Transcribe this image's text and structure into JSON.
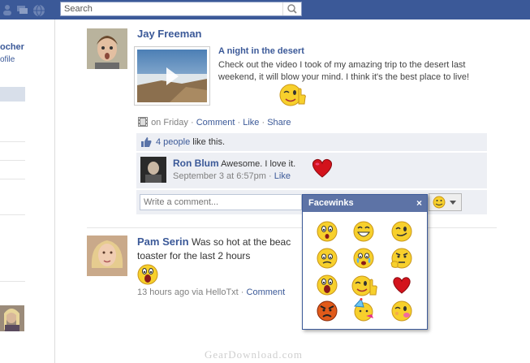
{
  "app": {
    "search_placeholder": "Search"
  },
  "left_column": {
    "name_fragment": "ocher",
    "profile_fragment": "ofile"
  },
  "posts": [
    {
      "author": "Jay Freeman",
      "video_title": "A night in the desert",
      "video_description": "Check out the video I took of my amazing trip to the desert last weekend, it will blow your mind. I think it's the best place to live!",
      "time": "on Friday",
      "actions": [
        "Comment",
        "Like",
        "Share"
      ],
      "likes_link": "4 people",
      "likes_suffix": "like this.",
      "comments": [
        {
          "author": "Ron Blum",
          "text": "Awesome. I love it.",
          "time": "September 3 at 6:57pm",
          "like": "Like"
        }
      ],
      "comment_placeholder": "Write a comment..."
    },
    {
      "author": "Pam Serin",
      "status_line1": "Was so hot at the beac",
      "status_line2": "toaster for the last 2 hours",
      "time": "13 hours ago via HelloTxt",
      "action": "Comment"
    }
  ],
  "facewinks_popup": {
    "title": "Facewinks",
    "close": "×",
    "smileys": [
      "surprised-icon",
      "grin-icon",
      "wink-icon",
      "worried-icon",
      "crying-icon",
      "thinking-icon",
      "shocked-icon",
      "thumbs-up-icon",
      "heart-icon",
      "angry-icon",
      "party-icon",
      "kiss-icon"
    ]
  },
  "watermark": "GearDownload.com",
  "colors": {
    "brand": "#3b5998",
    "panel": "#edeff4",
    "popup_header": "#5d73a6"
  }
}
